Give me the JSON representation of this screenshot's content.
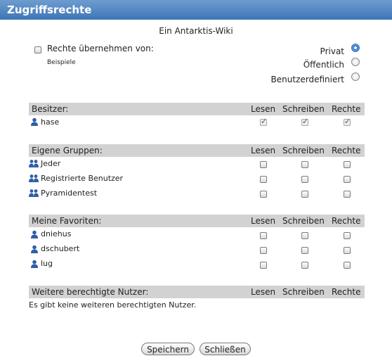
{
  "title": "Zugriffsrechte",
  "subtitle": "Ein Antarktis-Wiki",
  "inherit": {
    "label": "Rechte übernehmen von:",
    "example": "Beispiele"
  },
  "visibility": {
    "options": [
      "Privat",
      "Öffentlich",
      "Benutzerdefiniert"
    ],
    "selected": "Privat"
  },
  "columns": {
    "read": "Lesen",
    "write": "Schreiben",
    "rights": "Rechte"
  },
  "owner_section": {
    "label": "Besitzer:",
    "user": "hase"
  },
  "groups_section": {
    "label": "Eigene Gruppen:",
    "items": [
      "Jeder",
      "Registrierte Benutzer",
      "Pyramidentest"
    ]
  },
  "favorites_section": {
    "label": "Meine Favoriten:",
    "items": [
      "dniehus",
      "dschubert",
      "lug"
    ]
  },
  "more_section": {
    "label": "Weitere berechtigte Nutzer:",
    "empty_text": "Es gibt keine weiteren berechtigten Nutzer."
  },
  "buttons": {
    "save": "Speichern",
    "close": "Schließen"
  },
  "colors": {
    "titlebar": "#4f82be",
    "section_bg": "#d2d2d2",
    "icon_blue": "#2d5fa8"
  },
  "icons": {
    "user": "user-icon",
    "group": "group-icon"
  }
}
